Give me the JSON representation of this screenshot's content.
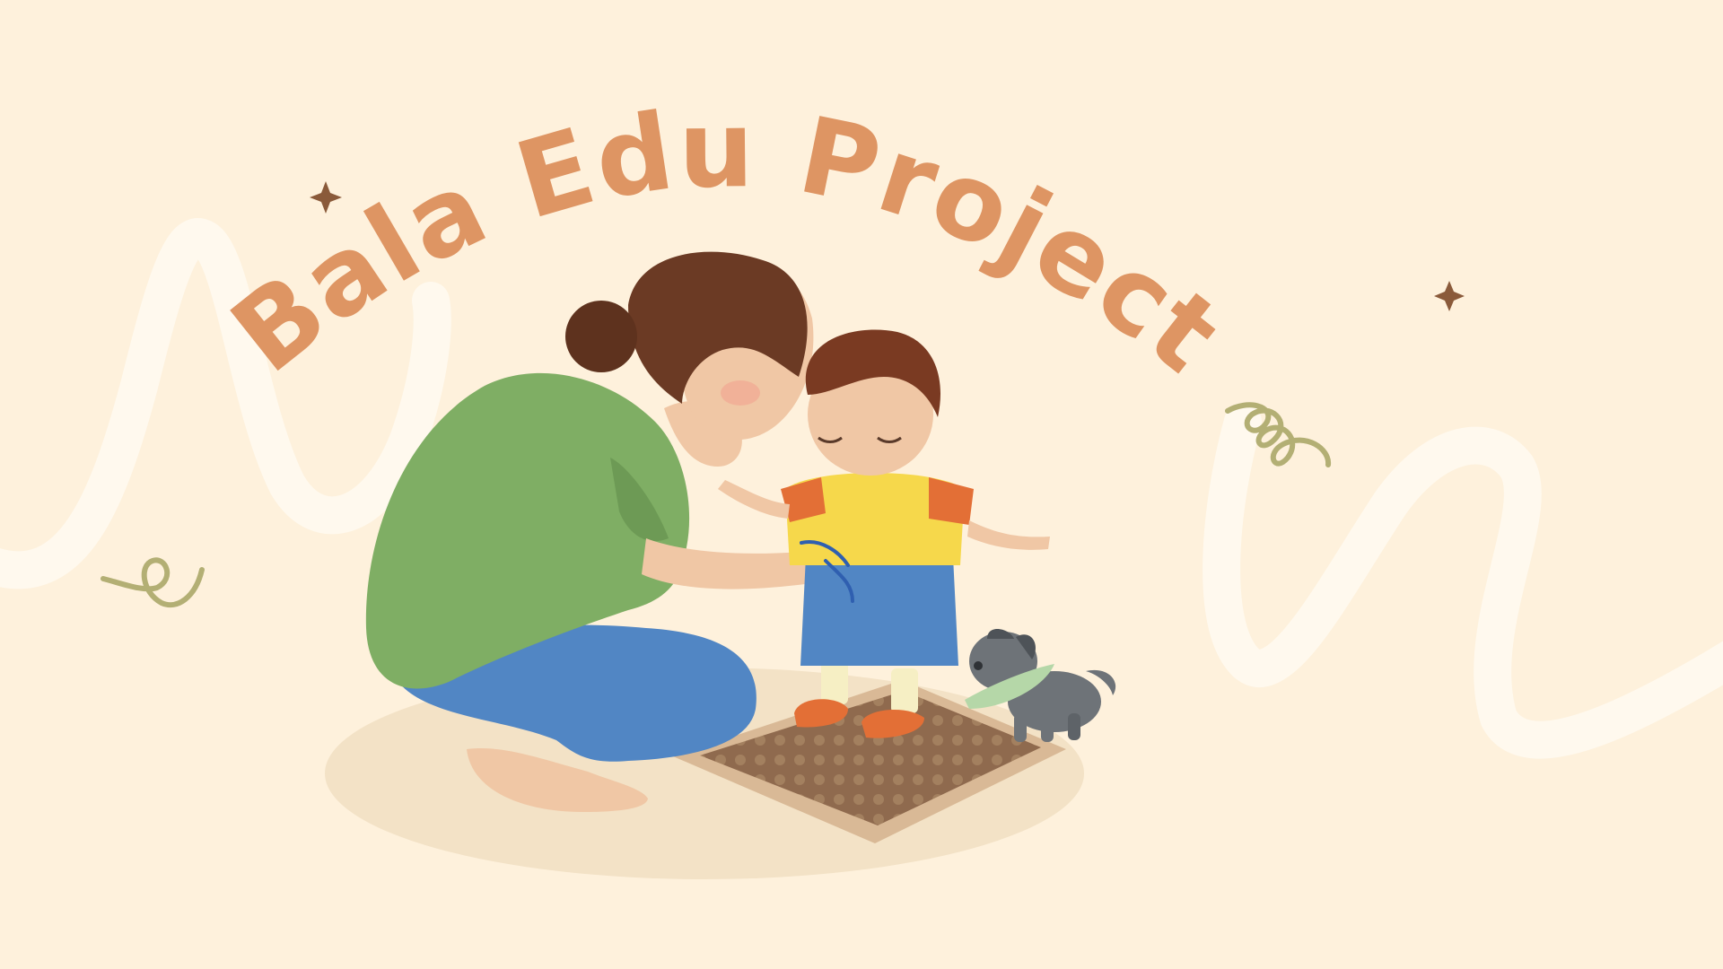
{
  "banner": {
    "title": "Bala Edu Project"
  },
  "colors": {
    "background": "#FEF1DC",
    "title": "#DE9563",
    "squiggle": "#FFF9EE",
    "sparkle": "#8A5A3A",
    "curl": "#B3AF74",
    "floor": "#F3E2C6"
  },
  "illustration": {
    "figures": [
      "mother-figure",
      "toddler-figure",
      "puppy-figure"
    ],
    "icons": [
      "sparkle-icon",
      "sparkle-icon",
      "curl-icon",
      "curl-icon"
    ]
  }
}
